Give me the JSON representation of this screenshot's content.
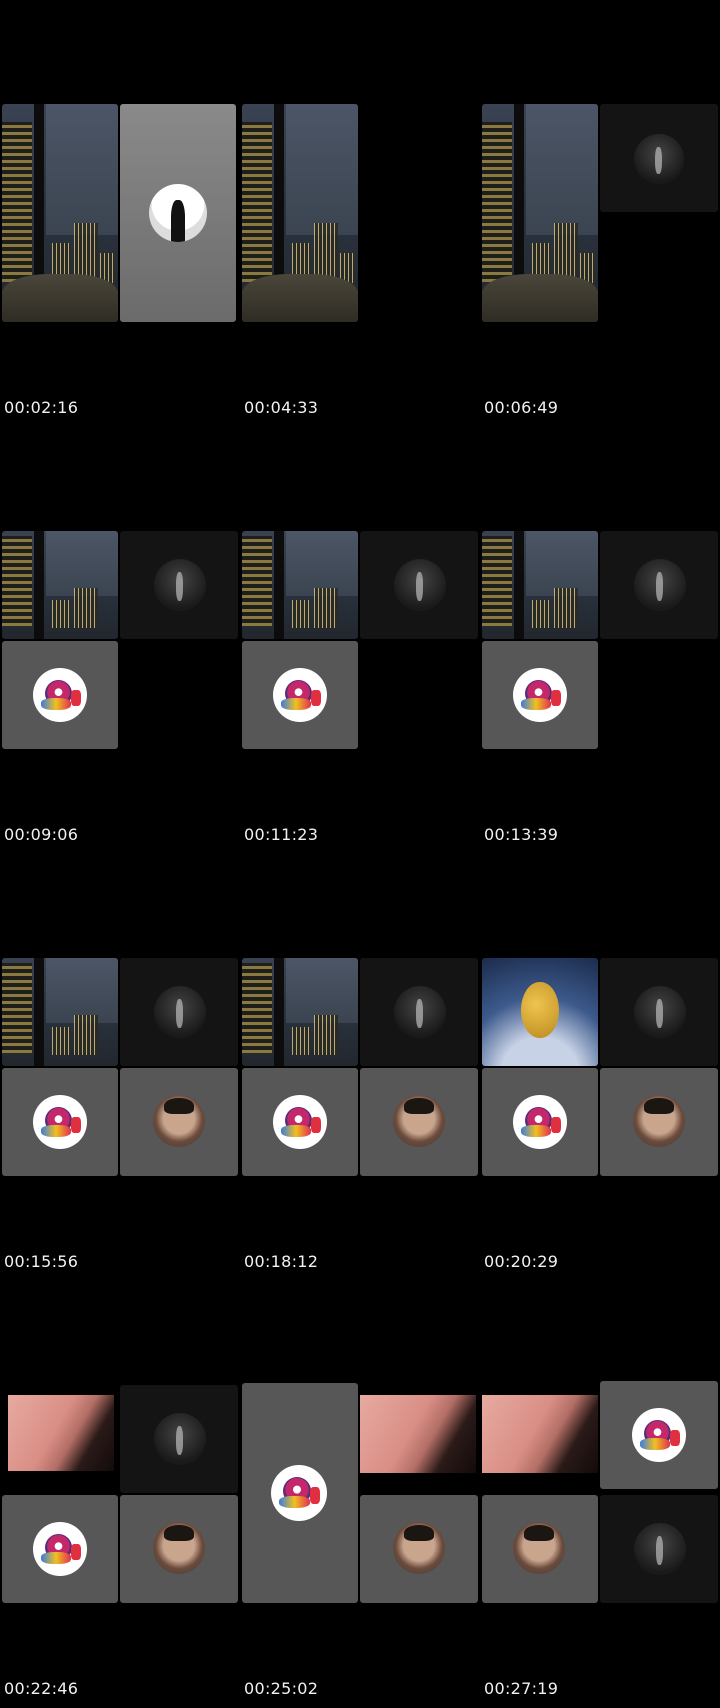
{
  "timestamps": [
    "00:02:16",
    "00:04:33",
    "00:06:49",
    "00:09:06",
    "00:11:23",
    "00:13:39",
    "00:15:56",
    "00:18:12",
    "00:20:29",
    "00:22:46",
    "00:25:02",
    "00:27:19"
  ],
  "icons": {
    "silhouette": "silhouette-avatar-icon",
    "night": "night-scene-avatar-icon",
    "robot": "robot-avatar-icon",
    "face": "person-avatar-icon"
  },
  "colors": {
    "background": "#000000",
    "timestamp_text": "#f2f2f2",
    "tile_gray": "#6a6a6a"
  }
}
